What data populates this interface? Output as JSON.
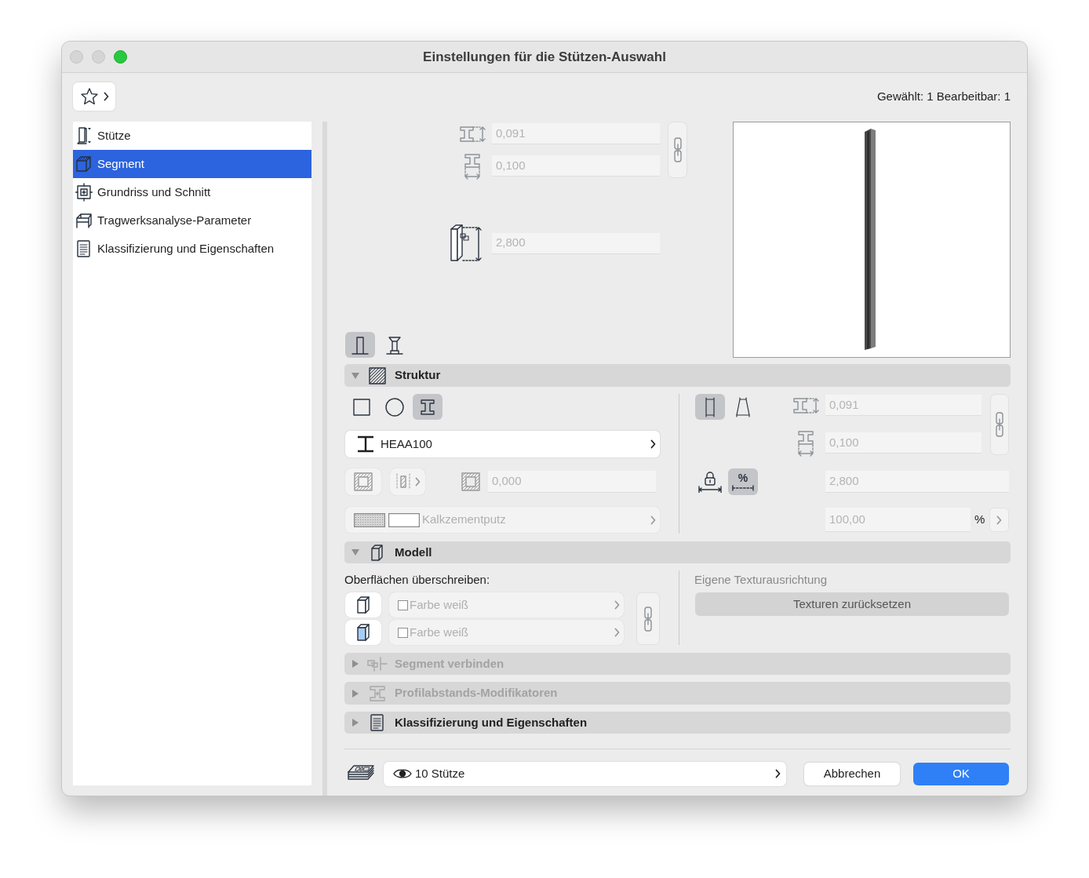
{
  "window": {
    "title": "Einstellungen für die Stützen-Auswahl",
    "controls": [
      {
        "kind": "close",
        "disabled": true
      },
      {
        "kind": "minimize",
        "disabled": true
      },
      {
        "kind": "zoom",
        "disabled": false
      }
    ]
  },
  "toolbar": {
    "selection_info": "Gewählt: 1 Bearbeitbar: 1"
  },
  "sidebar": {
    "items": [
      {
        "kind": "column",
        "label": "Stütze",
        "selected": false
      },
      {
        "kind": "segment",
        "label": "Segment",
        "selected": true
      },
      {
        "kind": "floor_plan",
        "label": "Grundriss und Schnitt",
        "selected": false
      },
      {
        "kind": "structural",
        "label": "Tragwerksanalyse-Parameter",
        "selected": false
      },
      {
        "kind": "document",
        "label": "Klassifizierung und Eigenschaften",
        "selected": false
      }
    ]
  },
  "segment": {
    "width": {
      "value": "0,091",
      "disabled": true
    },
    "depth": {
      "value": "0,100",
      "disabled": true
    },
    "height": {
      "value": "2,800",
      "disabled": true
    },
    "column_types": [
      {
        "kind": "plain",
        "selected": true
      },
      {
        "kind": "capital",
        "selected": false
      }
    ]
  },
  "struktur": {
    "title": "Struktur",
    "expanded": true,
    "shapes": [
      {
        "kind": "rectangle",
        "selected": false
      },
      {
        "kind": "circle",
        "selected": false
      },
      {
        "kind": "profile",
        "selected": true
      }
    ],
    "profile": "HEAA100",
    "core_thickness": {
      "value": "0,000",
      "disabled": true
    },
    "material": {
      "label": "Kalkzementputz",
      "disabled": true
    },
    "slant": [
      {
        "kind": "straight",
        "selected": true
      },
      {
        "kind": "tapered",
        "selected": false
      }
    ],
    "width": {
      "value": "0,091",
      "disabled": true
    },
    "depth": {
      "value": "0,100",
      "disabled": true
    },
    "length_modes": [
      {
        "kind": "lock",
        "selected": false
      },
      {
        "kind": "percent",
        "label": "%",
        "selected": true
      }
    ],
    "length": {
      "value": "2,800",
      "disabled": true
    },
    "ratio": {
      "value": "100,00",
      "disabled": true
    },
    "ratio_unit": "%"
  },
  "modell": {
    "title": "Modell",
    "expanded": true,
    "override_label": "Oberflächen überschreiben:",
    "surfaces": [
      {
        "kind": "outer",
        "label": "Farbe weiß",
        "checked": false,
        "disabled": true
      },
      {
        "kind": "inner",
        "label": "Farbe weiß",
        "checked": false,
        "disabled": true
      }
    ],
    "texture_label": "Eigene Texturausrichtung",
    "reset_button": "Texturen zurücksetzen"
  },
  "sections": [
    {
      "kind": "connect",
      "title": "Segment verbinden",
      "expanded": false,
      "disabled": true
    },
    {
      "kind": "spacing",
      "title": "Profilabstands-Modifikatoren",
      "expanded": false,
      "disabled": true
    },
    {
      "kind": "document",
      "title": "Klassifizierung und Eigenschaften",
      "expanded": false,
      "disabled": false
    }
  ],
  "footer": {
    "layer": "10 Stütze",
    "cancel": "Abbrechen",
    "ok": "OK"
  }
}
